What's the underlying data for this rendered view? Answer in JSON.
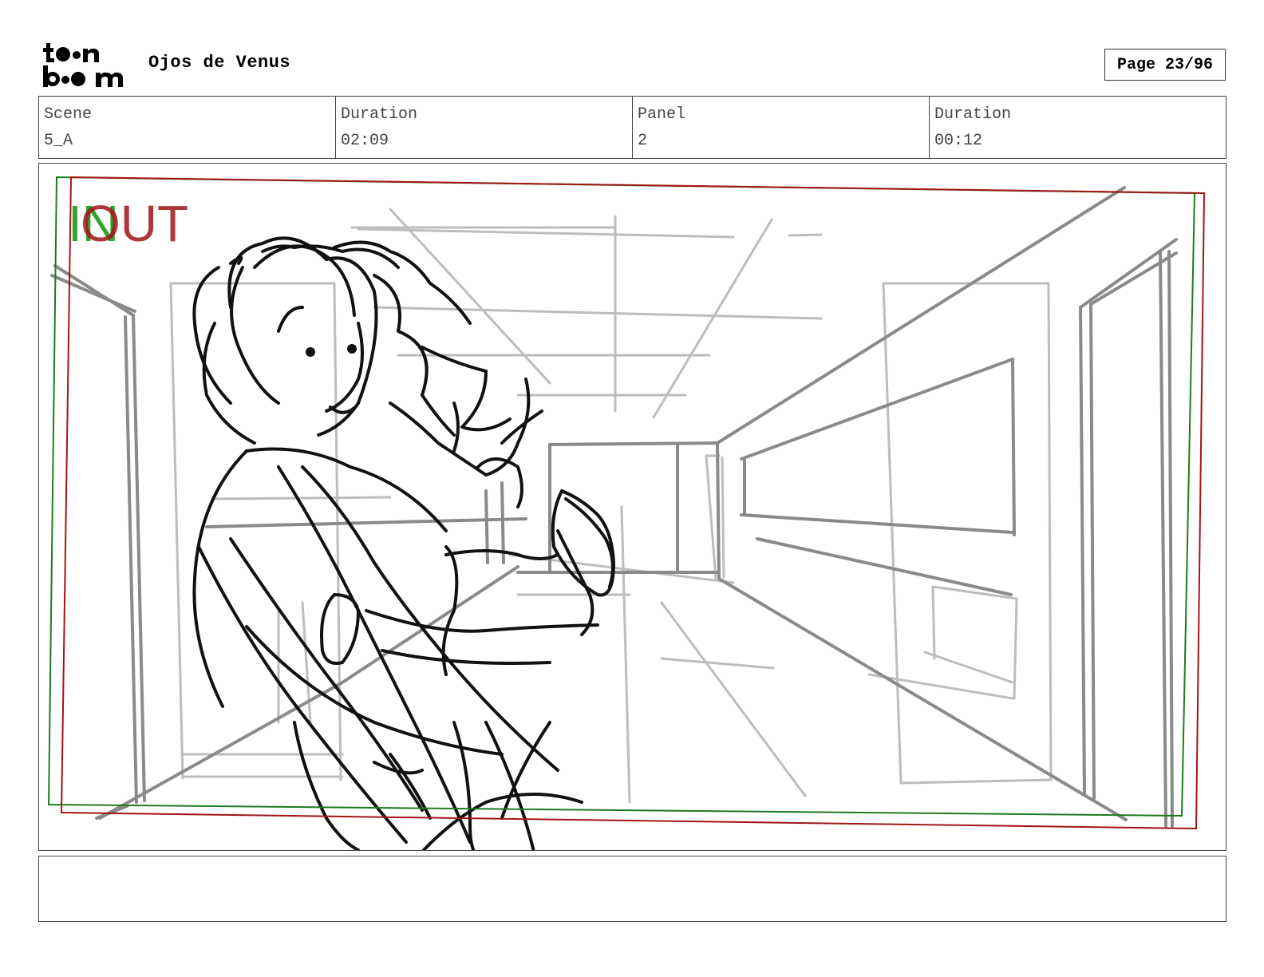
{
  "header": {
    "logo_text": "toon boom",
    "project_title": "Ojos de Venus",
    "page_label": "Page 23/96"
  },
  "info": {
    "scene_label": "Scene",
    "scene_value": "5_A",
    "scene_duration_label": "Duration",
    "scene_duration_value": "02:09",
    "panel_label": "Panel",
    "panel_value": "2",
    "panel_duration_label": "Duration",
    "panel_duration_value": "00:12"
  },
  "panel": {
    "in_label": "IN",
    "out_label": "OUT",
    "in_color": "#1a9a1a",
    "out_color": "#a31515"
  },
  "notes": {
    "text": ""
  }
}
